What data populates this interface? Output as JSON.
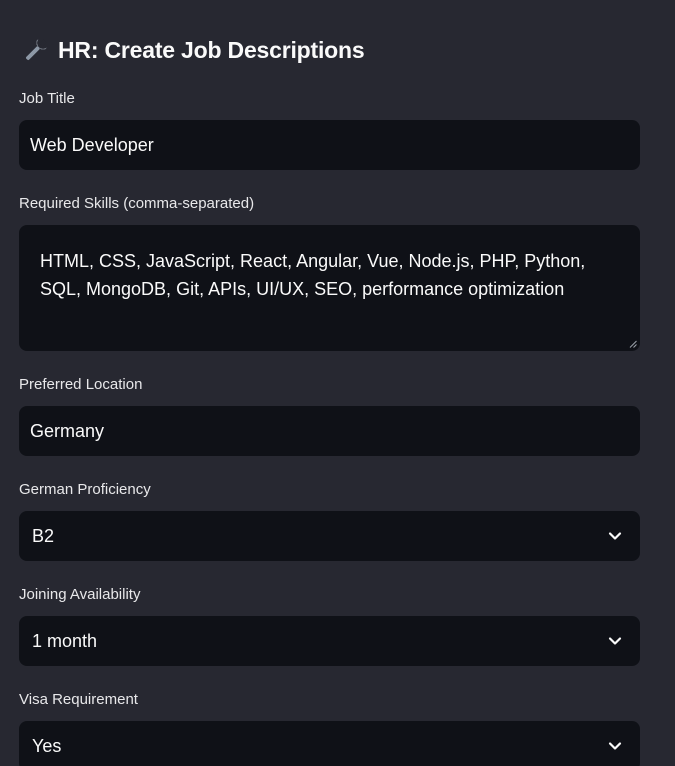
{
  "header": {
    "title": "HR: Create Job Descriptions",
    "icon": "wrench-icon"
  },
  "form": {
    "job_title": {
      "label": "Job Title",
      "value": "Web Developer"
    },
    "skills": {
      "label": "Required Skills (comma-separated)",
      "value": "HTML, CSS, JavaScript, React, Angular, Vue, Node.js, PHP, Python, SQL, MongoDB, Git, APIs, UI/UX, SEO, performance optimization"
    },
    "location": {
      "label": "Preferred Location",
      "value": "Germany"
    },
    "german": {
      "label": "German Proficiency",
      "value": "B2"
    },
    "joining": {
      "label": "Joining Availability",
      "value": "1 month"
    },
    "visa": {
      "label": "Visa Requirement",
      "value": "Yes"
    }
  },
  "colors": {
    "background": "#272831",
    "input_background": "#0f1117",
    "text": "#fafafa"
  }
}
